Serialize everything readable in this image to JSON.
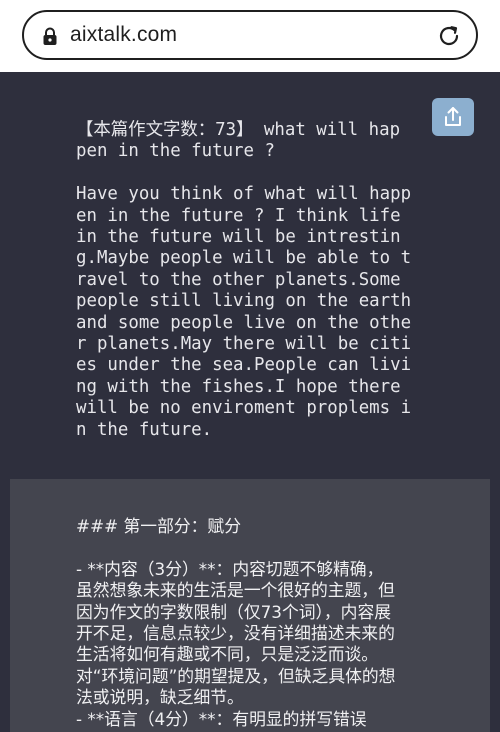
{
  "browser": {
    "url": "aixtalk.com",
    "lock_icon": "lock-icon",
    "reload_icon": "reload-icon"
  },
  "share": {
    "icon": "share-icon"
  },
  "essay": {
    "lines": [
      "【本篇作文字数：73】 what will hap",
      "pen in the future ?",
      "",
      "Have you think of what will happ",
      "en in the future ? I think life",
      "in the future will be intrestin",
      "g.Maybe people will be able to t",
      "ravel to the other planets.Some",
      "people still living on the earth",
      "and some people live on the othe",
      "r planets.May there will be citi",
      "es under the sea.People can livi",
      "ng with the fishes.I hope there",
      "will be no enviroment proplems i",
      "n the future."
    ]
  },
  "review": {
    "lines": [
      "### 第一部分：赋分",
      "",
      "- **内容（3分）**：内容切题不够精确，",
      "虽然想象未来的生活是一个很好的主题，但",
      "因为作文的字数限制（仅73个词），内容展",
      "开不足，信息点较少，没有详细描述未来的",
      "生活将如何有趣或不同，只是泛泛而谈。",
      "对“环境问题”的期望提及，但缺乏具体的想",
      "法或说明，缺乏细节。",
      "- **语言（4分）**：有明显的拼写错误"
    ]
  },
  "colors": {
    "background": "#2e2f3d",
    "panel": "#44454f",
    "share_button": "#8cafcf",
    "text": "#e6e6ea"
  }
}
